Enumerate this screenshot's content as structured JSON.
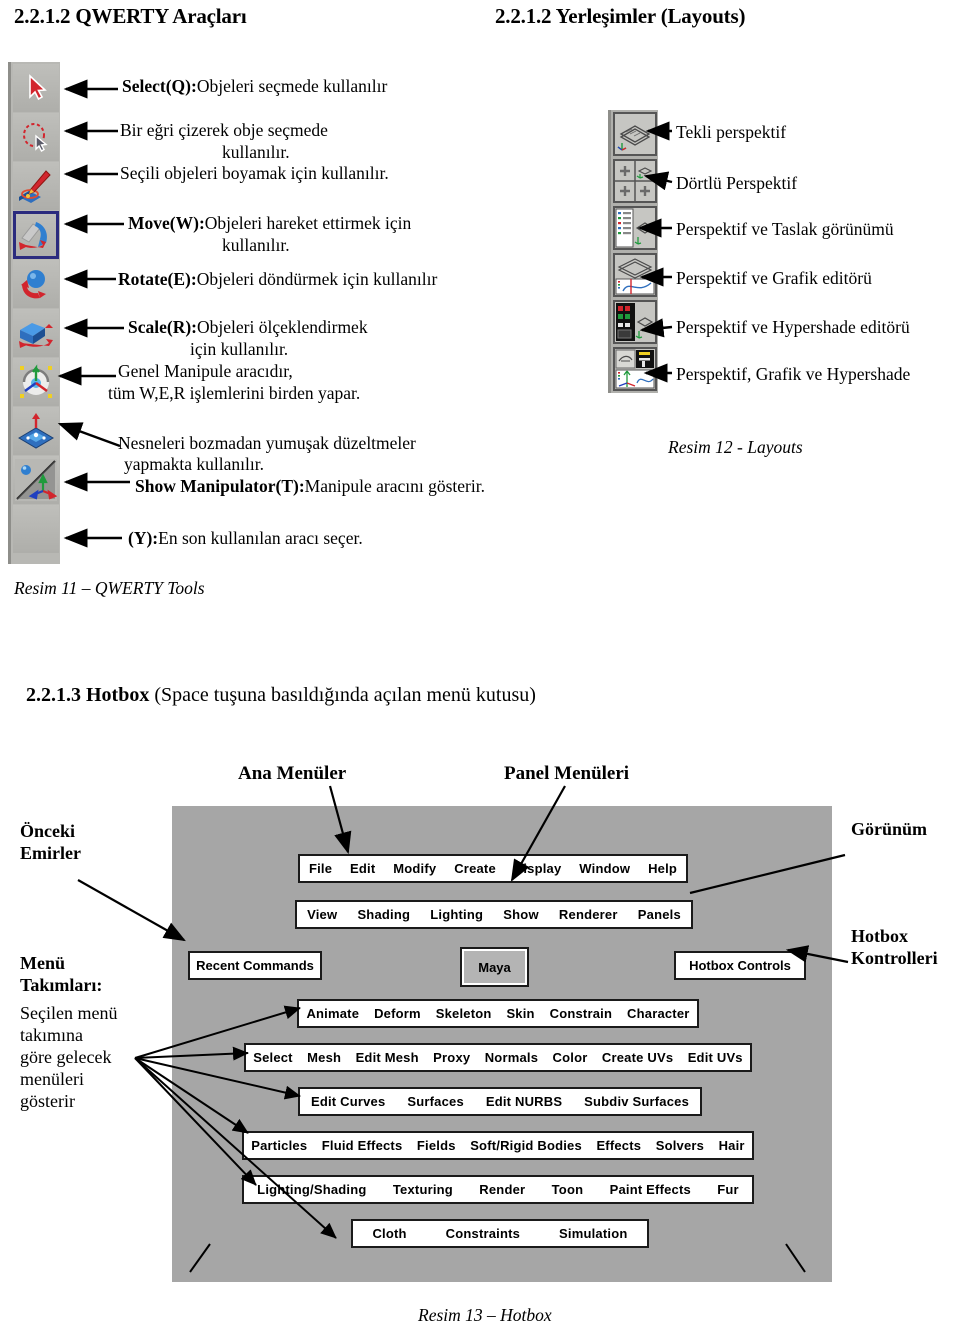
{
  "headings": {
    "left": "2.2.1.2 QWERTY Araçları",
    "right": "2.2.1.2 Yerleşimler (Layouts)"
  },
  "qwerty": {
    "tools": [
      {
        "name": "select-tool",
        "icon": "arrow-cursor-icon",
        "selected": false
      },
      {
        "name": "lasso-select-tool",
        "icon": "lasso-icon",
        "selected": false
      },
      {
        "name": "paint-select-tool",
        "icon": "paintbrush-icon",
        "selected": false
      },
      {
        "name": "move-tool",
        "icon": "move-arrow-icon",
        "selected": true
      },
      {
        "name": "rotate-tool",
        "icon": "rotate-sphere-icon",
        "selected": false
      },
      {
        "name": "scale-tool",
        "icon": "scale-cube-icon",
        "selected": false
      },
      {
        "name": "universal-manipulator-tool",
        "icon": "universal-manip-icon",
        "selected": false
      },
      {
        "name": "soft-modification-tool",
        "icon": "soft-mod-icon",
        "selected": false
      },
      {
        "name": "show-manipulator-tool",
        "icon": "show-manipulator-icon",
        "selected": false
      },
      {
        "name": "last-tool-used",
        "icon": "blank-icon",
        "selected": false
      }
    ],
    "descriptions": [
      {
        "bold": "Select(Q):",
        "rest": "Objeleri seçmede kullanılır"
      },
      {
        "bold": "",
        "rest": "Bir eğri çizerek obje seçmede"
      },
      {
        "bold": "",
        "rest": "kullanılır."
      },
      {
        "bold": "",
        "rest": "Seçili objeleri boyamak için kullanılır."
      },
      {
        "bold": "Move(W):",
        "rest": "Objeleri hareket ettirmek için"
      },
      {
        "bold": "",
        "rest": "kullanılır."
      },
      {
        "bold": "Rotate(E):",
        "rest": "Objeleri döndürmek için kullanılır"
      },
      {
        "bold": "Scale(R):",
        "rest": "Objeleri ölçeklendirmek"
      },
      {
        "bold": "",
        "rest": "için kullanılır."
      },
      {
        "bold": "",
        "rest": "Genel Manipule aracıdır,"
      },
      {
        "bold": "",
        "rest": "tüm W,E,R işlemlerini birden yapar."
      },
      {
        "bold": "",
        "rest": "Nesneleri bozmadan yumuşak düzeltmeler"
      },
      {
        "bold": "",
        "rest": "yapmakta kullanılır."
      },
      {
        "bold": "Show Manipulator(T):",
        "rest": "Manipule aracını gösterir."
      },
      {
        "bold": "(Y):",
        "rest": "En son kullanılan aracı seçer."
      }
    ],
    "lines": {
      "l1_bold": "Select(Q):",
      "l1_rest": "Objeleri seçmede kullanılır",
      "l2": "Bir eğri çizerek obje seçmede",
      "l3": "kullanılır.",
      "l4": "Seçili objeleri boyamak için kullanılır.",
      "l5_bold": "Move(W):",
      "l5_rest": "Objeleri hareket ettirmek için",
      "l6": "kullanılır.",
      "l7_bold": "Rotate(E):",
      "l7_rest": "Objeleri döndürmek için kullanılır",
      "l8_bold": "Scale(R):",
      "l8_rest": "Objeleri ölçeklendirmek",
      "l9": "için kullanılır.",
      "l10": "Genel Manipule aracıdır,",
      "l11": "tüm W,E,R işlemlerini birden yapar.",
      "l12": "Nesneleri bozmadan yumuşak düzeltmeler",
      "l13": "yapmakta kullanılır.",
      "l14_bold": "Show Manipulator(T):",
      "l14_rest": "Manipule aracını gösterir.",
      "l15_bold": "(Y):",
      "l15_rest": "En son kullanılan aracı seçer."
    },
    "caption": "Resim 11 – QWERTY Tools"
  },
  "layouts": {
    "items": [
      {
        "name": "single-perspective-layout",
        "label": "Tekli perspektif"
      },
      {
        "name": "four-view-perspective-layout",
        "label": "Dörtlü Perspektif"
      },
      {
        "name": "perspective-outliner-layout",
        "label": "Perspektif ve Taslak görünümü"
      },
      {
        "name": "perspective-graph-editor-layout",
        "label": "Perspektif ve Grafik editörü"
      },
      {
        "name": "perspective-hypershade-layout",
        "label": "Perspektif ve Hypershade editörü"
      },
      {
        "name": "perspective-graph-hypershade-layout",
        "label": "Perspektif, Grafik ve Hypershade"
      }
    ],
    "caption": "Resim 12 - Layouts"
  },
  "hotbox": {
    "heading_bold": "2.2.1.3 Hotbox",
    "heading_rest": " (Space tuşuna basıldığında açılan menü kutusu)",
    "top_labels": {
      "main_menus": "Ana Menüler",
      "panel_menus": "Panel Menüleri"
    },
    "side_labels": {
      "previous_commands": "Önceki\nEmirler",
      "menu_sets_bold": "Menü\nTakımları:",
      "menu_sets_rest": "Seçilen menü\ntakımına\ngöre gelecek\nmenüleri\ngösterir",
      "view": "Görünüm",
      "hotbox_controls": "Hotbox\nKontrolleri"
    },
    "rows": {
      "main": [
        "File",
        "Edit",
        "Modify",
        "Create",
        "Display",
        "Window",
        "Help"
      ],
      "panel": [
        "View",
        "Shading",
        "Lighting",
        "Show",
        "Renderer",
        "Panels"
      ],
      "animation": [
        "Animate",
        "Deform",
        "Skeleton",
        "Skin",
        "Constrain",
        "Character"
      ],
      "polygons": [
        "Select",
        "Mesh",
        "Edit Mesh",
        "Proxy",
        "Normals",
        "Color",
        "Create UVs",
        "Edit UVs"
      ],
      "surfaces": [
        "Edit Curves",
        "Surfaces",
        "Edit NURBS",
        "Subdiv Surfaces"
      ],
      "dynamics": [
        "Particles",
        "Fluid Effects",
        "Fields",
        "Soft/Rigid Bodies",
        "Effects",
        "Solvers",
        "Hair"
      ],
      "rendering": [
        "Lighting/Shading",
        "Texturing",
        "Render",
        "Toon",
        "Paint Effects",
        "Fur"
      ],
      "cloth": [
        "Cloth",
        "Constraints",
        "Simulation"
      ]
    },
    "recent_commands": "Recent Commands",
    "hotbox_controls_box": "Hotbox Controls",
    "maya_center": "Maya",
    "caption": "Resim 13 – Hotbox"
  },
  "colors": {
    "panel_gray": "#a6a6a6",
    "toolbar_gray": "#b8b8b4",
    "border_black": "#1a1a1a",
    "select_outline": "#2b2b7e"
  }
}
